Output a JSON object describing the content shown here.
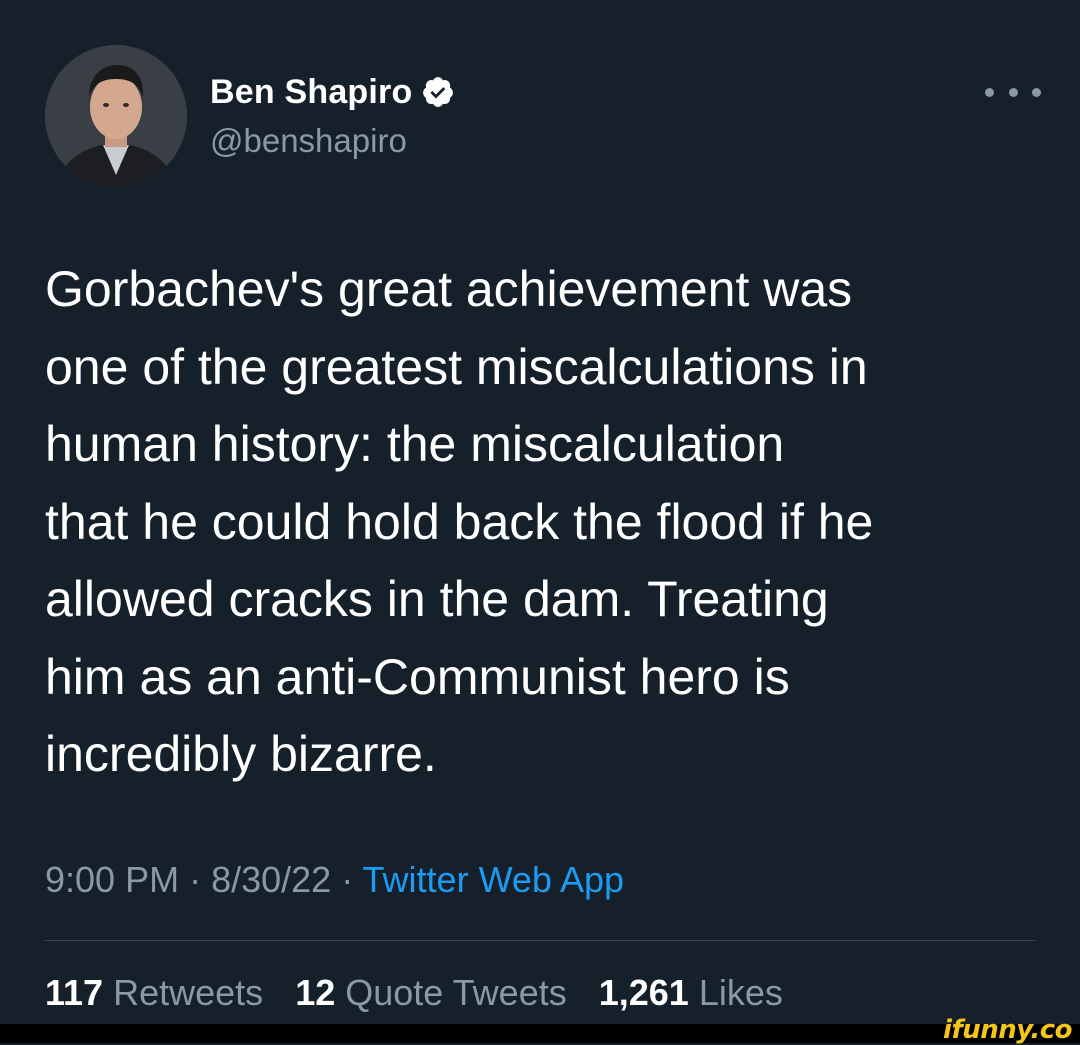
{
  "author": {
    "name": "Ben Shapiro",
    "handle": "@benshapiro",
    "verified_icon": "verified-badge-icon"
  },
  "more_icon": "more-horizontal-icon",
  "tweet": {
    "lines": [
      "Gorbachev's great achievement was",
      "one of the greatest miscalculations in",
      "human history: the miscalculation",
      "that he could hold back the flood if he",
      "allowed cracks in the dam. Treating",
      "him as an anti-Communist hero is",
      "incredibly bizarre."
    ]
  },
  "meta": {
    "time": "9:00 PM",
    "separator": " · ",
    "date": "8/30/22",
    "source": "Twitter Web App"
  },
  "stats": {
    "retweets": {
      "count": "117",
      "label": "Retweets"
    },
    "quote_tweets": {
      "count": "12",
      "label": "Quote Tweets"
    },
    "likes": {
      "count": "1,261",
      "label": "Likes"
    }
  },
  "watermark": "ifunny.co",
  "colors": {
    "background": "#15202b",
    "text": "#ffffff",
    "secondary": "#8b98a5",
    "link": "#1d9bf0",
    "divider": "#38444d",
    "watermark": "#f5c518"
  }
}
